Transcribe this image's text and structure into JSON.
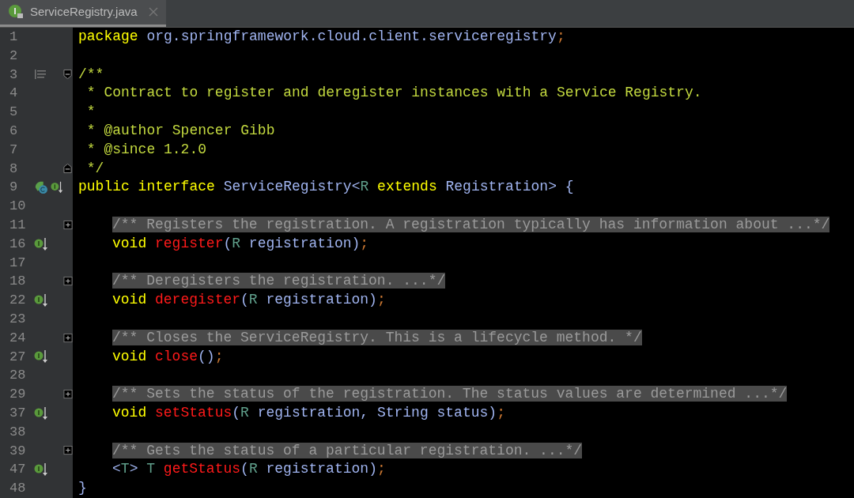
{
  "tab": {
    "title": "ServiceRegistry.java",
    "selected": true
  },
  "lines": [
    {
      "number": "1",
      "tokens": [
        {
          "text": "package",
          "kind": "keyword"
        },
        {
          "text": " org.springframework.cloud.client.serviceregistry",
          "kind": "name"
        },
        {
          "text": ";",
          "kind": "punct"
        }
      ]
    },
    {
      "number": "2"
    },
    {
      "number": "3",
      "markers": [
        {
          "kind": "structure"
        }
      ],
      "fold": {
        "kind": "start"
      },
      "tokens": [
        {
          "text": "/**",
          "kind": "doc"
        }
      ]
    },
    {
      "number": "4",
      "tokens": [
        {
          "text": " * Contract to register and deregister instances with a Service Registry.",
          "kind": "doc"
        }
      ]
    },
    {
      "number": "5",
      "tokens": [
        {
          "text": " *",
          "kind": "doc"
        }
      ]
    },
    {
      "number": "6",
      "tokens": [
        {
          "text": " * @author Spencer Gibb",
          "kind": "doc"
        }
      ]
    },
    {
      "number": "7",
      "tokens": [
        {
          "text": " * @since 1.2.0",
          "kind": "doc"
        }
      ]
    },
    {
      "number": "8",
      "fold": {
        "kind": "end"
      },
      "tokens": [
        {
          "text": " */",
          "kind": "doc"
        }
      ]
    },
    {
      "number": "9",
      "markers": [
        {
          "kind": "bean"
        },
        {
          "kind": "implemented"
        }
      ],
      "tokens": [
        {
          "text": "public interface",
          "kind": "keyword"
        },
        {
          "text": " ServiceRegistry<",
          "kind": "name"
        },
        {
          "text": "R",
          "kind": "typeparam"
        },
        {
          "text": " extends",
          "kind": "keyword"
        },
        {
          "text": " Registration> {",
          "kind": "name"
        }
      ]
    },
    {
      "number": "10"
    },
    {
      "number": "11",
      "indent": true,
      "fold": {
        "kind": "collapsed"
      },
      "tokens": [
        {
          "text": "/** Registers the registration. A registration typically has information about ...*/",
          "kind": "folded"
        }
      ]
    },
    {
      "number": "16",
      "indent": true,
      "markers": [
        {
          "kind": "implemented"
        }
      ],
      "tokens": [
        {
          "text": "void",
          "kind": "keyword"
        },
        {
          "text": " register",
          "kind": "method"
        },
        {
          "text": "(",
          "kind": "name"
        },
        {
          "text": "R",
          "kind": "typeparam"
        },
        {
          "text": " registration)",
          "kind": "name"
        },
        {
          "text": ";",
          "kind": "punct"
        }
      ]
    },
    {
      "number": "17"
    },
    {
      "number": "18",
      "indent": true,
      "fold": {
        "kind": "collapsed"
      },
      "tokens": [
        {
          "text": "/** Deregisters the registration. ...*/",
          "kind": "folded"
        }
      ]
    },
    {
      "number": "22",
      "indent": true,
      "markers": [
        {
          "kind": "implemented"
        }
      ],
      "tokens": [
        {
          "text": "void",
          "kind": "keyword"
        },
        {
          "text": " deregister",
          "kind": "method"
        },
        {
          "text": "(",
          "kind": "name"
        },
        {
          "text": "R",
          "kind": "typeparam"
        },
        {
          "text": " registration)",
          "kind": "name"
        },
        {
          "text": ";",
          "kind": "punct"
        }
      ]
    },
    {
      "number": "23"
    },
    {
      "number": "24",
      "indent": true,
      "fold": {
        "kind": "collapsed"
      },
      "tokens": [
        {
          "text": "/** Closes the ServiceRegistry. This is a lifecycle method. */",
          "kind": "folded"
        }
      ]
    },
    {
      "number": "27",
      "indent": true,
      "markers": [
        {
          "kind": "implemented"
        }
      ],
      "tokens": [
        {
          "text": "void",
          "kind": "keyword"
        },
        {
          "text": " close",
          "kind": "method"
        },
        {
          "text": "()",
          "kind": "name"
        },
        {
          "text": ";",
          "kind": "punct"
        }
      ]
    },
    {
      "number": "28"
    },
    {
      "number": "29",
      "indent": true,
      "fold": {
        "kind": "collapsed"
      },
      "tokens": [
        {
          "text": "/** Sets the status of the registration. The status values are determined ...*/",
          "kind": "folded"
        }
      ]
    },
    {
      "number": "37",
      "indent": true,
      "markers": [
        {
          "kind": "implemented"
        }
      ],
      "tokens": [
        {
          "text": "void",
          "kind": "keyword"
        },
        {
          "text": " setStatus",
          "kind": "method"
        },
        {
          "text": "(",
          "kind": "name"
        },
        {
          "text": "R",
          "kind": "typeparam"
        },
        {
          "text": " registration, ",
          "kind": "name"
        },
        {
          "text": "String",
          "kind": "name"
        },
        {
          "text": " status)",
          "kind": "name"
        },
        {
          "text": ";",
          "kind": "punct"
        }
      ]
    },
    {
      "number": "38"
    },
    {
      "number": "39",
      "indent": true,
      "fold": {
        "kind": "collapsed"
      },
      "tokens": [
        {
          "text": "/** Gets the status of a particular registration. ...*/",
          "kind": "folded"
        }
      ]
    },
    {
      "number": "47",
      "indent": true,
      "markers": [
        {
          "kind": "implemented"
        }
      ],
      "tokens": [
        {
          "text": "<",
          "kind": "name"
        },
        {
          "text": "T",
          "kind": "typeparam"
        },
        {
          "text": "> ",
          "kind": "name"
        },
        {
          "text": "T",
          "kind": "typeparam"
        },
        {
          "text": " getStatus",
          "kind": "method"
        },
        {
          "text": "(",
          "kind": "name"
        },
        {
          "text": "R",
          "kind": "typeparam"
        },
        {
          "text": " registration)",
          "kind": "name"
        },
        {
          "text": ";",
          "kind": "punct"
        }
      ]
    },
    {
      "number": "48",
      "tokens": [
        {
          "text": "}",
          "kind": "name"
        }
      ]
    }
  ]
}
